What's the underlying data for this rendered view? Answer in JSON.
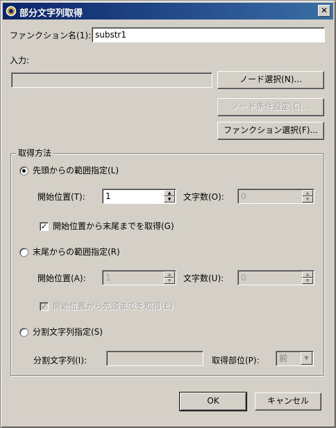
{
  "window": {
    "title": "部分文字列取得",
    "close_glyph": "✕",
    "icon": "gear-icon"
  },
  "function_name": {
    "label": "ファンクション名(1):",
    "value": "substr1"
  },
  "input": {
    "label": "入力:",
    "value": "",
    "buttons": {
      "node_select": "ノード選択(N)...",
      "node_condition": "ノード条件設定(C)...",
      "function_select": "ファンクション選択(F)..."
    }
  },
  "method": {
    "group_title": "取得方法",
    "from_start": {
      "radio_label": "先頭からの範囲指定(L)",
      "selected": true,
      "start_pos_label": "開始位置(T):",
      "start_pos_value": "1",
      "char_count_label": "文字数(O):",
      "char_count_value": "0",
      "to_end_label": "開始位置から末尾までを取得(G)",
      "to_end_checked": true
    },
    "from_end": {
      "radio_label": "末尾からの範囲指定(R)",
      "selected": false,
      "start_pos_label": "開始位置(A):",
      "start_pos_value": "1",
      "char_count_label": "文字数(U):",
      "char_count_value": "0",
      "to_start_label": "開始位置から先頭までを取得(E)",
      "to_start_checked": true
    },
    "split": {
      "radio_label": "分割文字列指定(S)",
      "selected": false,
      "split_string_label": "分割文字列(I):",
      "split_string_value": "",
      "part_label": "取得部位(P):",
      "part_value": "前"
    }
  },
  "footer": {
    "ok": "OK",
    "cancel": "キャンセル"
  }
}
